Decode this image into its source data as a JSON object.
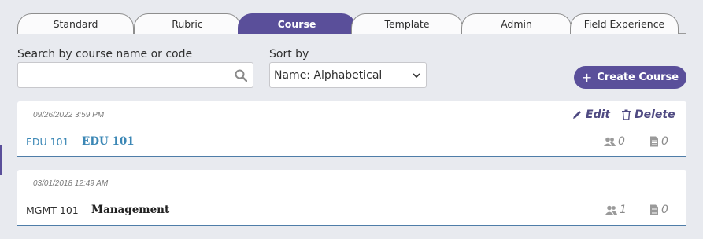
{
  "tabs": [
    "Standard",
    "Rubric",
    "Course",
    "Template",
    "Admin",
    "Field Experience"
  ],
  "active_tab": "Course",
  "search": {
    "label": "Search by course name or code",
    "value": "",
    "placeholder": ""
  },
  "sort": {
    "label": "Sort by",
    "selected": "Name: Alphabetical"
  },
  "create_button": {
    "label": "Create Course"
  },
  "courses": [
    {
      "timestamp": "09/26/2022 3:59 PM",
      "code": "EDU 101",
      "name": "EDU 101",
      "edit_label": "Edit",
      "delete_label": "Delete",
      "users": "0",
      "docs": "0"
    },
    {
      "timestamp": "03/01/2018 12:49 AM",
      "code": "MGMT 101",
      "name": "Management",
      "users": "1",
      "docs": "0"
    }
  ],
  "colors": {
    "accent": "#5a4f9a",
    "link": "#3b87b5",
    "action": "#4f4a82"
  }
}
